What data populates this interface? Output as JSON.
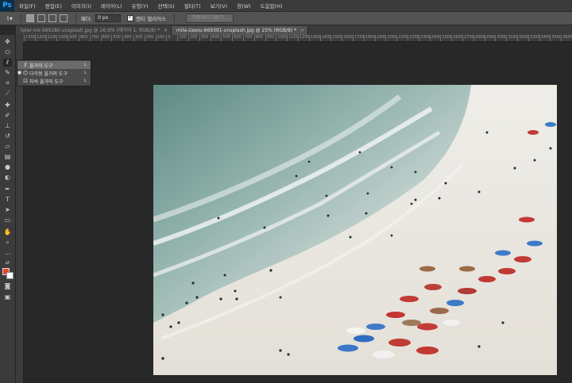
{
  "app": {
    "logo": "Ps"
  },
  "menu": [
    "파일(F)",
    "편집(E)",
    "이미지(I)",
    "레이어(L)",
    "유형(Y)",
    "선택(S)",
    "필터(T)",
    "보기(V)",
    "창(W)",
    "도움말(H)"
  ],
  "options_bar": {
    "feather_label": "페더:",
    "feather_value": "0 px",
    "antialias_label": "앤티 앨리어스",
    "refine_edge_button": "가장자리 다듬기..."
  },
  "tabs": [
    {
      "title": "tyler-nix-569180-unsplash.jpg @ 26.9% (레이어 1, RGB/8) *",
      "close": "×"
    },
    {
      "title": "mila-zasou-669391-unsplash.jpg @ 25% (RGB/8) *",
      "close": "×"
    }
  ],
  "ruler_top": [
    "1300",
    "1200",
    "1100",
    "1000",
    "900",
    "800",
    "700",
    "600",
    "500",
    "400",
    "300",
    "200",
    "100",
    "0",
    "100",
    "200",
    "300",
    "400",
    "500",
    "600",
    "700",
    "800",
    "900",
    "1000",
    "1100",
    "1200",
    "1300",
    "1400",
    "1500",
    "1600",
    "1700",
    "1800",
    "1900",
    "2000",
    "2100",
    "2200",
    "2300",
    "2400",
    "2500",
    "2600",
    "2700",
    "2800",
    "2900",
    "3000",
    "3100",
    "3200",
    "3300",
    "3400",
    "3500",
    "3600"
  ],
  "flyout": [
    {
      "label": "올가미 도구",
      "key": "L",
      "icon": "lasso-icon"
    },
    {
      "label": "다각형 올가미 도구",
      "key": "L",
      "icon": "polygonal-lasso-icon"
    },
    {
      "label": "자석 올가미 도구",
      "key": "L",
      "icon": "magnetic-lasso-icon"
    }
  ],
  "colors": {
    "foreground": "#e8462a",
    "background": "#ffffff",
    "sea": "#6f9b93",
    "sand": "#efece6"
  }
}
